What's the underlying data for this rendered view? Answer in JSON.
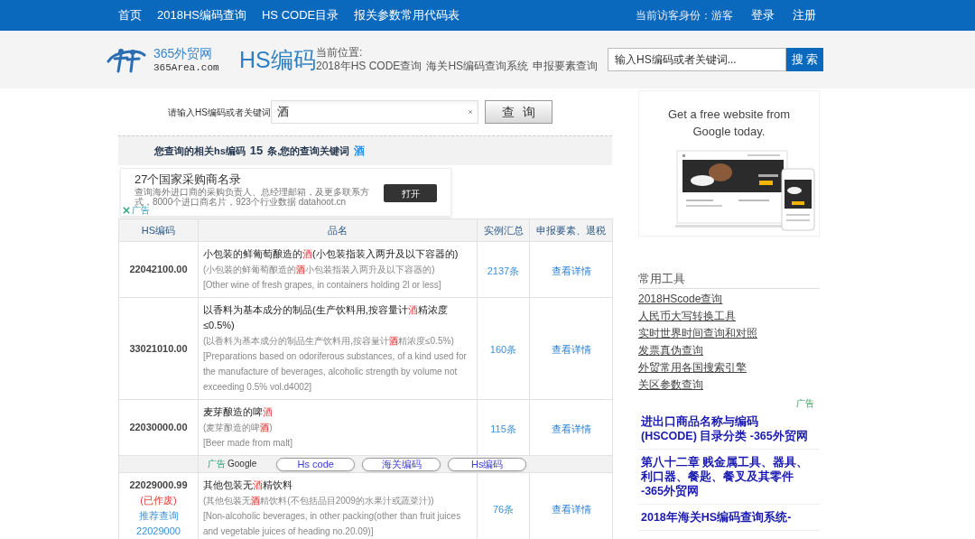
{
  "top_nav": {
    "links": [
      "首页",
      "2018HS编码查询",
      "HS CODE目录",
      "报关参数常用代码表"
    ],
    "visitor": "当前访客身份：游客",
    "account_links": [
      "登录",
      "注册"
    ]
  },
  "header": {
    "logo_name": "365外贸网",
    "logo_domain": "365Area.com",
    "section_title": "HS编码",
    "breadcrumb_label": "当前位置:",
    "breadcrumb": [
      "2018年HS CODE查询",
      "海关HS编码查询系统",
      "申报要素查询"
    ],
    "search": {
      "placeholder": "输入HS编码或者关键词...",
      "button": "搜索"
    }
  },
  "query": {
    "label": "请输入HS编码或者关键词",
    "value": "酒",
    "button": "查询"
  },
  "summary": {
    "prefix": "您查询的相关hs编码",
    "count": "15",
    "suffix": "条,您的查询关键词",
    "keyword": "酒"
  },
  "ad_banner": {
    "title": "27个国家采购商名录",
    "description": "查询海外进口商的采购负责人、总经理邮箱，及更多联系方式，8000个进口商名片，923个行业数据 datahoot.cn",
    "button": "打开",
    "ad_label": "广告"
  },
  "table": {
    "columns": [
      "HS编码",
      "品名",
      "实例汇总",
      "申报要素、退税"
    ],
    "rows": [
      {
        "kind": "item",
        "code": "22042100.00",
        "name_lines": [
          {
            "kind": "title",
            "parts": [
              {
                "text": "小包装的鲜葡萄酿造的",
                "highlight": false
              },
              {
                "text": "酒",
                "highlight": true
              },
              {
                "text": "(小包装指装入两升及以下容器的)",
                "highlight": false
              }
            ]
          },
          {
            "kind": "cn",
            "parts": [
              {
                "text": "(小包装的鲜葡萄酿造的",
                "highlight": false
              },
              {
                "text": "酒",
                "highlight": true
              },
              {
                "text": "小包装指装入两升及以下容器的)",
                "highlight": false
              }
            ]
          },
          {
            "kind": "en",
            "parts": [
              {
                "text": "[Other wine of fresh grapes, in containers holding 2l or less]",
                "highlight": false
              }
            ]
          }
        ],
        "examples": "2137条",
        "details": "查看详情"
      },
      {
        "kind": "item",
        "code": "33021010.00",
        "name_lines": [
          {
            "kind": "title",
            "parts": [
              {
                "text": "以香料为基本成分的制品(生产饮料用,按容量计",
                "highlight": false
              },
              {
                "text": "酒",
                "highlight": true
              },
              {
                "text": "精浓度≤0.5%)",
                "highlight": false
              }
            ]
          },
          {
            "kind": "cn",
            "parts": [
              {
                "text": "(以香料为基本成分的制品生产饮料用,按容量计",
                "highlight": false
              },
              {
                "text": "酒",
                "highlight": true
              },
              {
                "text": "精浓度≤0.5%)",
                "highlight": false
              }
            ]
          },
          {
            "kind": "en",
            "parts": [
              {
                "text": "[Preparations based on odoriferous substances, of a kind used for the manufacture of beverages, alcoholic strength by volume not exceeding 0.5% vol.d4002]",
                "highlight": false
              }
            ]
          }
        ],
        "examples": "160条",
        "details": "查看详情"
      },
      {
        "kind": "item",
        "code": "22030000.00",
        "name_lines": [
          {
            "kind": "title",
            "parts": [
              {
                "text": "麦芽酿造的啤",
                "highlight": false
              },
              {
                "text": "酒",
                "highlight": true
              }
            ]
          },
          {
            "kind": "cn",
            "parts": [
              {
                "text": "(麦芽酿造的啤",
                "highlight": false
              },
              {
                "text": "酒",
                "highlight": true
              },
              {
                "text": ")",
                "highlight": false
              }
            ]
          },
          {
            "kind": "en",
            "parts": [
              {
                "text": "[Beer made from malt]",
                "highlight": false
              }
            ]
          }
        ],
        "examples": "115条",
        "details": "查看详情"
      },
      {
        "kind": "ad",
        "label": "广告",
        "provider": "Google",
        "links": [
          "Hs code",
          "海关编码",
          "Hs编码"
        ]
      },
      {
        "kind": "item",
        "code": "22029000.99",
        "status": "(已作废)",
        "recommend_label": "推荐查询",
        "recommend_code": "22029000",
        "name_lines": [
          {
            "kind": "title",
            "parts": [
              {
                "text": "其他包装无",
                "highlight": false
              },
              {
                "text": "酒",
                "highlight": true
              },
              {
                "text": "精饮料",
                "highlight": false
              }
            ]
          },
          {
            "kind": "cn",
            "parts": [
              {
                "text": "(其他包装无",
                "highlight": false
              },
              {
                "text": "酒",
                "highlight": true
              },
              {
                "text": "精饮料(不包括品目2009的水果汁或蔬菜汁))",
                "highlight": false
              }
            ]
          },
          {
            "kind": "en",
            "parts": [
              {
                "text": "[Non-alcoholic beverages, in other packing(other than fruit juices and vegetable juices of heading no.20.09)]",
                "highlight": false
              }
            ]
          }
        ],
        "examples": "76条",
        "details": "查看详情"
      }
    ]
  },
  "sidebar": {
    "ad": {
      "headline": "Get a free website from Google today."
    },
    "tools": {
      "title": "常用工具",
      "links": [
        "2018HScode查询",
        "人民币大写转换工具",
        "实时世界时间查询和对照",
        "发票真伪查询",
        "外贸常用各国搜索引擎",
        "关区参数查询"
      ]
    },
    "ads": {
      "label": "广告",
      "links": [
        "进出口商品名称与编码 (HSCODE) 目录分类 -365外贸网",
        "第八十二章 贱金属工具、器具、利口器、餐匙、餐叉及其零件 -365外贸网",
        "2018年海关HS编码查询系统-"
      ]
    }
  }
}
